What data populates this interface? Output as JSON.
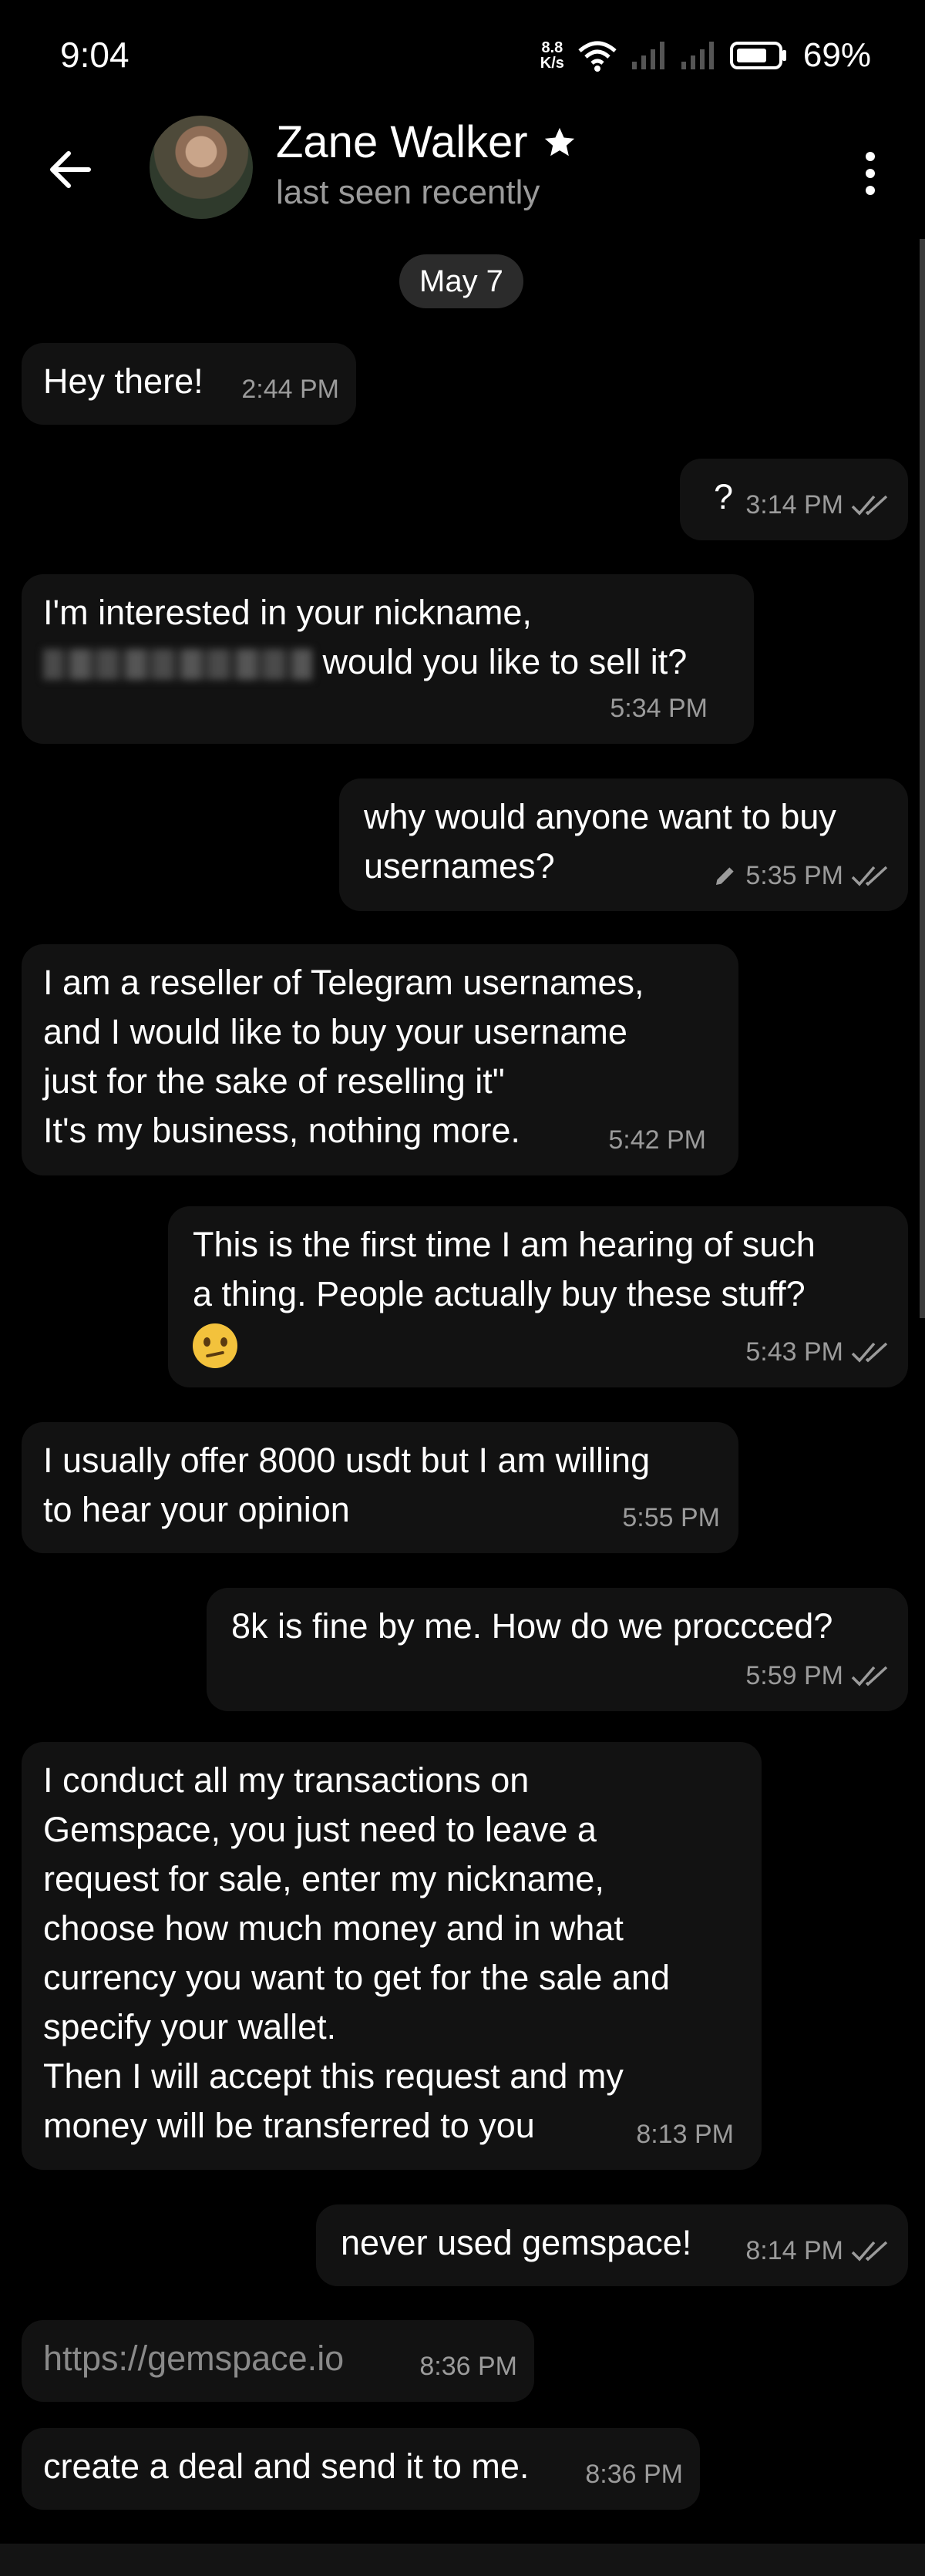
{
  "status": {
    "time": "9:04",
    "net_speed_value": "8.8",
    "net_speed_unit": "K/s",
    "battery": "69%"
  },
  "header": {
    "name": "Zane Walker",
    "last_seen": "last seen recently"
  },
  "date_separator": "May 7",
  "messages": [
    {
      "side": "in",
      "text": "Hey there!",
      "time": "2:44 PM"
    },
    {
      "side": "out",
      "text": "?",
      "time": "3:14 PM"
    },
    {
      "side": "in",
      "text_line1": "I'm interested in your nickname,",
      "text_line2": "would you like to sell it?",
      "time": "5:34 PM"
    },
    {
      "side": "out",
      "text": "why would anyone want to buy\nusernames?",
      "time": "5:35 PM",
      "edited": true
    },
    {
      "side": "in",
      "text": "I am a reseller of Telegram usernames,\nand I would like to buy your username\njust for the sake of reselling it\"\nIt's my business, nothing more.",
      "time": "5:42 PM"
    },
    {
      "side": "out",
      "text": "This is the first time I am hearing of such\na thing. People actually buy these stuff?",
      "time": "5:43 PM"
    },
    {
      "side": "in",
      "text": "I usually offer 8000 usdt but I am willing\nto hear your opinion",
      "time": "5:55 PM"
    },
    {
      "side": "out",
      "text": "8k is fine by me. How do we proccced?",
      "time": "5:59 PM"
    },
    {
      "side": "in",
      "text": "I conduct all my transactions on\nGemspace, you just need to leave a\nrequest for sale, enter my nickname,\nchoose how much money and in what\ncurrency you want to get for the sale and\nspecify your wallet.\nThen I will accept this request and my\nmoney will be transferred to you",
      "time": "8:13 PM"
    },
    {
      "side": "out",
      "text": "never used gemspace!",
      "time": "8:14 PM"
    },
    {
      "side": "in",
      "text": "https://gemspace.io",
      "time": "8:36 PM"
    },
    {
      "side": "in",
      "text": "create a deal and send it to me.",
      "time": "8:36 PM"
    }
  ],
  "icons": {
    "back": "arrow-left-icon",
    "star": "star-icon",
    "menu": "more-vertical-icon",
    "read": "double-check-icon",
    "edited": "pencil-icon",
    "emoji": "confused-face-emoji"
  }
}
